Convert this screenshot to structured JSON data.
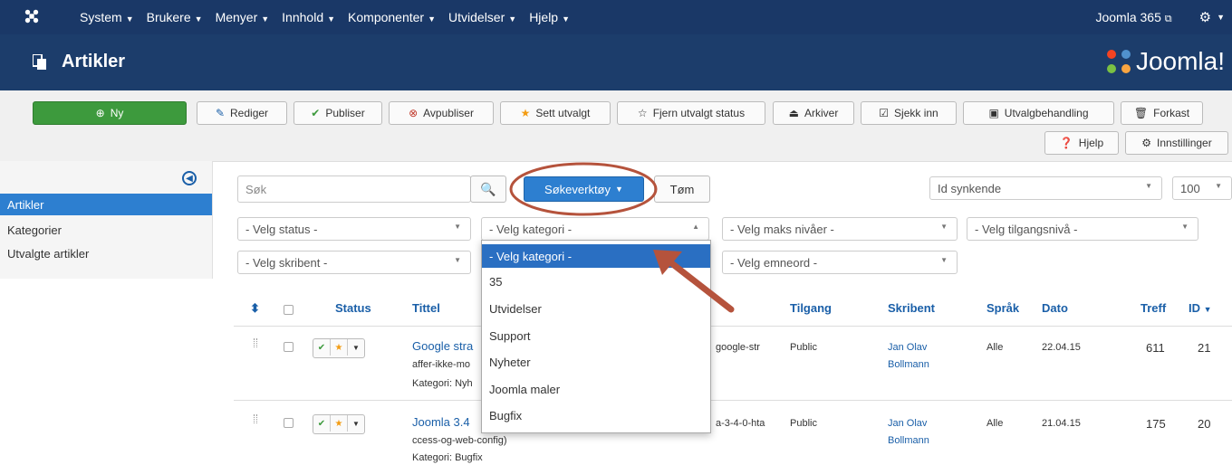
{
  "topnav": {
    "menu": [
      "System",
      "Brukere",
      "Menyer",
      "Innhold",
      "Komponenter",
      "Utvidelser",
      "Hjelp"
    ],
    "site_link": "Joomla 365",
    "icons": [
      "joomla-icon",
      "external-link-icon",
      "gear-icon"
    ]
  },
  "page": {
    "title": "Artikler",
    "brand": "Joomla!"
  },
  "toolbar": {
    "new": "Ny",
    "edit": "Rediger",
    "publish": "Publiser",
    "unpublish": "Avpubliser",
    "feature": "Sett utvalgt",
    "unfeature": "Fjern utvalgt status",
    "archive": "Arkiver",
    "checkin": "Sjekk inn",
    "batch": "Utvalgbehandling",
    "trash": "Forkast",
    "help": "Hjelp",
    "options": "Innstillinger"
  },
  "sidebar": {
    "items": [
      "Artikler",
      "Kategorier",
      "Utvalgte artikler"
    ],
    "active": "Artikler"
  },
  "filters": {
    "search_placeholder": "Søk",
    "search_tools": "Søkeverktøy",
    "clear": "Tøm",
    "ordering": "Id synkende",
    "limit": "100",
    "status": "- Velg status -",
    "category": "- Velg kategori -",
    "max_levels": "- Velg maks nivåer -",
    "access": "- Velg tilgangsnivå -",
    "author": "- Velg skribent -",
    "tags": "- Velg emneord -"
  },
  "category_dropdown": {
    "options": [
      "- Velg kategori -",
      "35",
      "Utvidelser",
      "Support",
      "Nyheter",
      "Joomla maler",
      "Bugfix"
    ],
    "highlighted": "- Velg kategori -"
  },
  "table": {
    "headers": {
      "status": "Status",
      "title": "Tittel",
      "access": "Tilgang",
      "author": "Skribent",
      "language": "Språk",
      "date": "Dato",
      "hits": "Treff",
      "id": "ID"
    },
    "rows": [
      {
        "title": "Google stra",
        "alias_start": "affer-ikke-mo",
        "alias_end": "google-str",
        "category": "Kategori: Nyh",
        "access": "Public",
        "author_first": "Jan Olav",
        "author_last": "Bollmann",
        "language": "Alle",
        "date": "22.04.15",
        "hits": "611",
        "id": "21"
      },
      {
        "title": "Joomla 3.4",
        "alias_start": "ccess-og-web-config)",
        "alias_end": "a-3-4-0-hta",
        "category": "Kategori: Bugfix",
        "access": "Public",
        "author_first": "Jan Olav",
        "author_last": "Bollmann",
        "language": "Alle",
        "date": "21.04.15",
        "hits": "175",
        "id": "20"
      }
    ]
  },
  "colors": {
    "nav": "#1a3867",
    "header": "#1c3d6b",
    "accent": "#2d7fd0",
    "highlight_ring": "#b5533c"
  }
}
